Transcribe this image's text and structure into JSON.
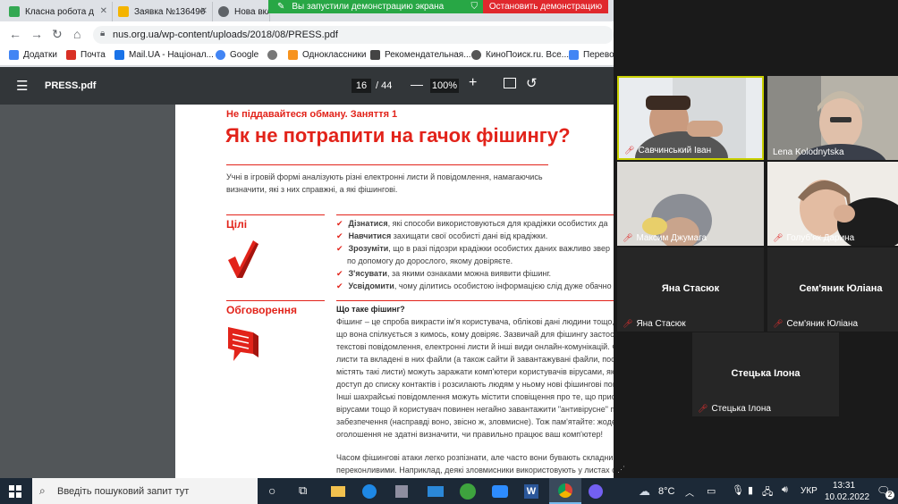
{
  "tabs": [
    {
      "title": "Класна робота д",
      "color": "#34a853"
    },
    {
      "title": "Заявка №136496",
      "color": "#f4b400"
    },
    {
      "title": "Нова вкла",
      "color": "#5f6368"
    }
  ],
  "share_banner": {
    "text": "Вы запустили демонстрацию экрана",
    "stop": "Остановить демонстрацию"
  },
  "url": "nus.org.ua/wp-content/uploads/2018/08/PRESS.pdf",
  "bookmarks": [
    {
      "label": "Додатки",
      "color": "#4285f4"
    },
    {
      "label": "Почта",
      "color": "#d93025"
    },
    {
      "label": "Mail.UA - Націонал...",
      "color": "#1a73e8"
    },
    {
      "label": "Google",
      "color": "#4285f4"
    },
    {
      "label": "",
      "color": "#777"
    },
    {
      "label": "Одноклассники",
      "color": "#f7931e"
    },
    {
      "label": "Рекомендательная...",
      "color": "#444"
    },
    {
      "label": "КиноПоиск.ru. Все...",
      "color": "#555"
    },
    {
      "label": "Перевод",
      "color": "#4285f4"
    }
  ],
  "pdf": {
    "title": "PRESS.pdf",
    "page": "16",
    "total": "/ 44",
    "zoom": "100%",
    "kicker": "Не піддавайтеся обману. Заняття 1",
    "heading": "Як не потрапити на гачок фішингу?",
    "intro1": "Учні в ігровій формі аналізують різні електронні листи й повідомлення, намагаючись",
    "intro2": "визначити, які з них справжні, а які фішингові.",
    "goals_label": "Цілі",
    "goals": [
      {
        "bold": "Дізнатися",
        "rest": ", які способи використовуються для крадіжки особистих да"
      },
      {
        "bold": "Навчитися",
        "rest": " захищати свої особисті дані від крадіжки."
      },
      {
        "bold": "Зрозуміти",
        "rest": ", що в разі підозри крадіжки особистих даних важливо звер"
      },
      {
        "bold": "",
        "rest": "по допомогу до дорослого, якому довіряєте."
      },
      {
        "bold": "З'ясувати",
        "rest": ", за якими ознаками можна виявити фішинг."
      },
      {
        "bold": "Усвідомити",
        "rest": ", чому ділитись особистою інформацією слід дуже обачно"
      }
    ],
    "discussion_label": "Обговорення",
    "q_title": "Що таке фішинг?",
    "body": [
      "Фішинг – це спроба викрасти ім'я користувача, облікові дані людини тощо, прете",
      "що вона спілкується з кимось, кому довіряє. Зазвичай для фішингу застос",
      "текстові повідомлення, електронні листи й інші види онлайн-комунікацій. Ф",
      "листи та вкладені в них файли (а також сайти й завантажувані файли, посила",
      "містять такі листи) можуть заражати комп'ютери користувачів вірусами, які о",
      "доступ до списку контактів і розсилають людям у ньому нові фішингові повід",
      "Інші шахрайські повідомлення можуть містити сповіщення про те, що пристрій",
      "вірусами тощо й користувач повинен негайно завантажити \"антивірусне\" пр",
      "забезпечення (насправді воно, звісно ж, зловмисне). Тож пам'ятайте: жоде",
      "оголошення не здатні визначити, чи правильно працює ваш комп'ютер!",
      "",
      "Часом фішингові атаки легко розпізнати, але часто вони бувають складним",
      "переконливими. Наприклад, деякі зловмисники використовують у листах с"
    ]
  },
  "participants": [
    {
      "name": "Савчинський Іван",
      "tile_label": "",
      "video": true
    },
    {
      "name": "Lena Kolodnytska",
      "tile_label": "",
      "video": true
    },
    {
      "name": "Максим Джумага",
      "tile_label": "",
      "video": true
    },
    {
      "name": "Голуб'як Дарина",
      "tile_label": "",
      "video": true
    },
    {
      "name": "Яна Стасюк",
      "tile_label": "Яна Стасюк",
      "video": false
    },
    {
      "name": "Сем'яник Юліана",
      "tile_label": "Сем'яник Юліана",
      "video": false
    },
    {
      "name": "Стецька Ілона",
      "tile_label": "Стецька Ілона",
      "video": false
    }
  ],
  "taskbar": {
    "search_placeholder": "Введіть пошуковий запит тут",
    "weather": "8°C",
    "lang": "УКР",
    "time": "13:31",
    "date": "10.02.2022",
    "notif_count": "2"
  }
}
